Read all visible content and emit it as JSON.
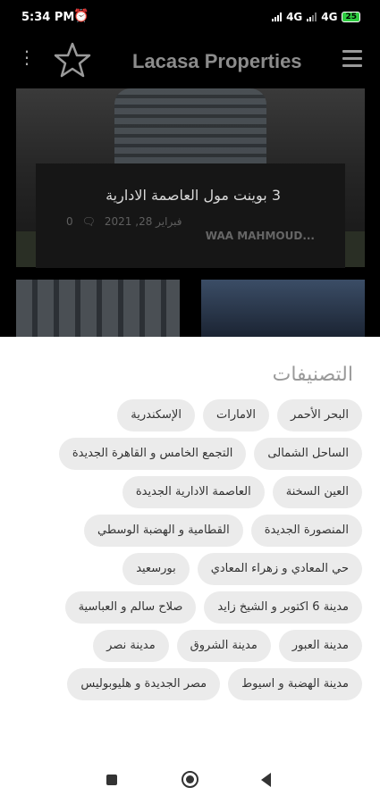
{
  "status": {
    "time": "5:34 PM",
    "net1": "4G",
    "net2": "4G",
    "battery": "25"
  },
  "appbar": {
    "title": "Lacasa Properties"
  },
  "featured": {
    "title": "3 بوينت مول العاصمة الادارية",
    "date": "فبراير 28, 2021",
    "comments": "0",
    "author": "WAA MAHMOUD..."
  },
  "sheet": {
    "heading": "التصنيفات",
    "categories": [
      "البحر الأحمر",
      "الامارات",
      "الإسكندرية",
      "الساحل الشمالى",
      "التجمع الخامس و القاهرة الجديدة",
      "العين السخنة",
      "العاصمة الادارية الجديدة",
      "المنصورة الجديدة",
      "القطامية و الهضبة الوسطي",
      "حي المعادي و زهراء المعادي",
      "بورسعيد",
      "مدينة 6 اكتوبر و الشيخ زايد",
      "صلاح سالم و العباسية",
      "مدينة العبور",
      "مدينة الشروق",
      "مدينة نصر",
      "مدينة الهضبة و اسيوط",
      "مصر الجديدة و هليوبوليس"
    ]
  }
}
